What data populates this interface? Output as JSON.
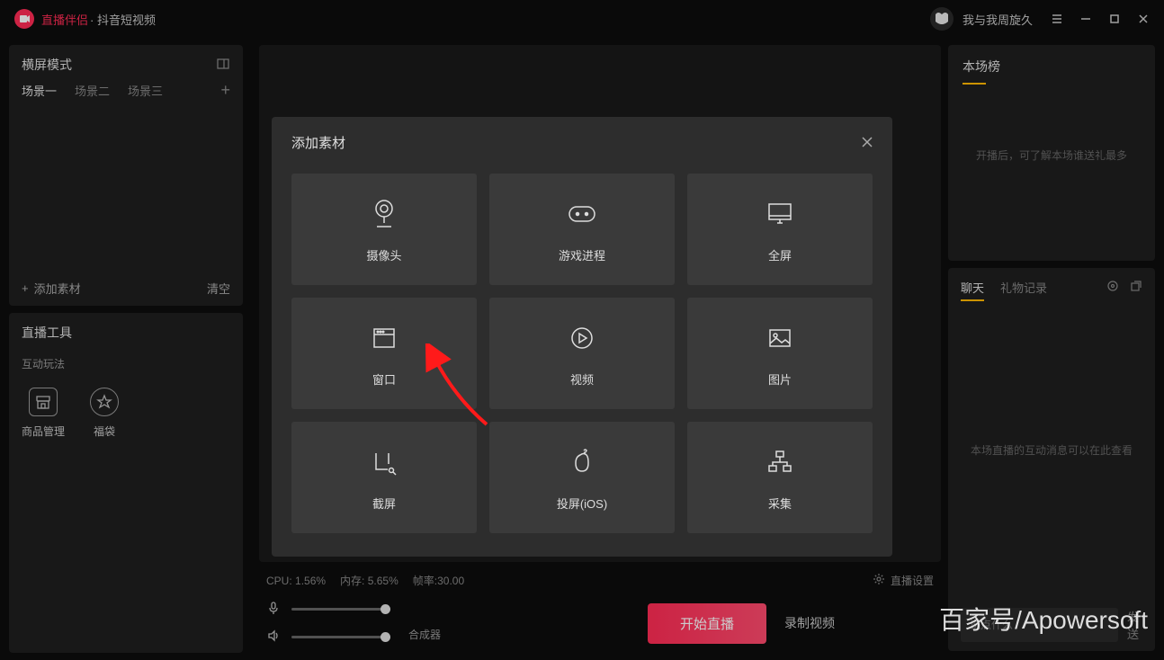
{
  "titlebar": {
    "app_name1": "直播伴侣",
    "app_name2": "· 抖音短视频",
    "username": "我与我周旋久"
  },
  "left": {
    "mode_title": "横屏模式",
    "scene_tabs": [
      "场景一",
      "场景二",
      "场景三"
    ],
    "add_material": "添加素材",
    "clear": "清空",
    "tools_title": "直播工具",
    "tools_sub": "互动玩法",
    "tool1": "商品管理",
    "tool2": "福袋"
  },
  "stats": {
    "cpu_label": "CPU:",
    "cpu_val": "1.56%",
    "mem_label": "内存:",
    "mem_val": "5.65%",
    "fps_label": "帧率:",
    "fps_val": "30.00",
    "settings": "直播设置"
  },
  "controls": {
    "synth": "合成器",
    "start": "开始直播",
    "record": "录制视频"
  },
  "right": {
    "rank_title": "本场榜",
    "rank_hint": "开播后，可了解本场谁送礼最多",
    "chat_tab1": "聊天",
    "chat_tab2": "礼物记录",
    "chat_hint": "本场直播的互动消息可以在此查看",
    "chat_placeholder": "说点什么",
    "chat_send": "发送"
  },
  "modal": {
    "title": "添加素材",
    "tiles": [
      "摄像头",
      "游戏进程",
      "全屏",
      "窗口",
      "视频",
      "图片",
      "截屏",
      "投屏(iOS)",
      "采集"
    ]
  },
  "watermark": "百家号/Apowersoft"
}
